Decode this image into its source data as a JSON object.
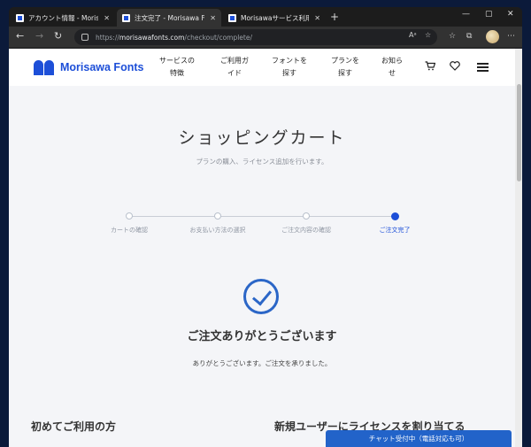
{
  "browser": {
    "tabs": [
      {
        "title": "アカウント情報 - Morisawa ID",
        "close": "✕",
        "active": false
      },
      {
        "title": "注文完了 - Morisawa Fonts",
        "close": "✕",
        "active": true
      },
      {
        "title": "Morisawaサービス利用規約 - Mori",
        "close": "✕",
        "active": false
      }
    ],
    "new_tab": "+",
    "window_controls": {
      "minimize": "—",
      "maximize": "▢",
      "close": "✕"
    },
    "nav": {
      "back": "←",
      "forward": "→",
      "reload": "↻"
    },
    "url_prefix": "https://",
    "url_host": "morisawafonts.com",
    "url_path": "/checkout/complete/",
    "read_aloud": "Aᵃ"
  },
  "site": {
    "logo_text": "Morisawa Fonts",
    "nav": [
      {
        "line1": "サービスの",
        "line2": "特徴"
      },
      {
        "line1": "ご利用ガ",
        "line2": "イド"
      },
      {
        "line1": "フォントを",
        "line2": "探す"
      },
      {
        "line1": "プランを",
        "line2": "探す"
      },
      {
        "line1": "お知ら",
        "line2": "せ"
      }
    ]
  },
  "page": {
    "title": "ショッピングカート",
    "subtitle": "プランの購入、ライセンス追加を行います。",
    "steps": [
      {
        "label": "カートの確認"
      },
      {
        "label": "お支払い方法の選択"
      },
      {
        "label": "ご注文内容の確認"
      },
      {
        "label": "ご注文完了"
      }
    ],
    "current_step": 4,
    "thanks_title": "ご注文ありがとうございます",
    "thanks_text": "ありがとうございます。ご注文を承りました。",
    "section_first": "初めてご利用の方",
    "section_new_user": "新規ユーザーにライセンスを割り当てる",
    "chat_label": "チャット受付中（電話対応も可）"
  },
  "colors": {
    "brand": "#1d4fd8",
    "chat": "#2263c9"
  }
}
